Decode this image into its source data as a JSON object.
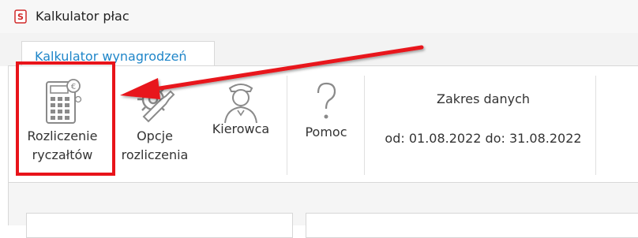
{
  "window": {
    "title": "Kalkulator płac",
    "icon": "payroll-app-icon"
  },
  "tabs": [
    {
      "label": "Kalkulator wynagrodzeń",
      "active": true
    }
  ],
  "ribbon": {
    "buttons": [
      {
        "label_line1": "Rozliczenie",
        "label_line2": "ryczałtów",
        "icon": "calculator-icon"
      },
      {
        "label_line1": "Opcje",
        "label_line2": "rozliczenia",
        "icon": "wrench-gear-icon"
      },
      {
        "label_line1": "Kierowca",
        "label_line2": "",
        "icon": "driver-icon"
      },
      {
        "label_line1": "Pomoc",
        "label_line2": "",
        "icon": "question-icon"
      }
    ],
    "date_range": {
      "title": "Zakres danych",
      "from_label": "od:",
      "from_value": "01.08.2022",
      "to_label": "do:",
      "to_value": "31.08.2022"
    }
  },
  "annotation": {
    "highlight_color": "#e8141a"
  },
  "colors": {
    "tab_text": "#1f86c9",
    "accent_red": "#e8141a"
  }
}
